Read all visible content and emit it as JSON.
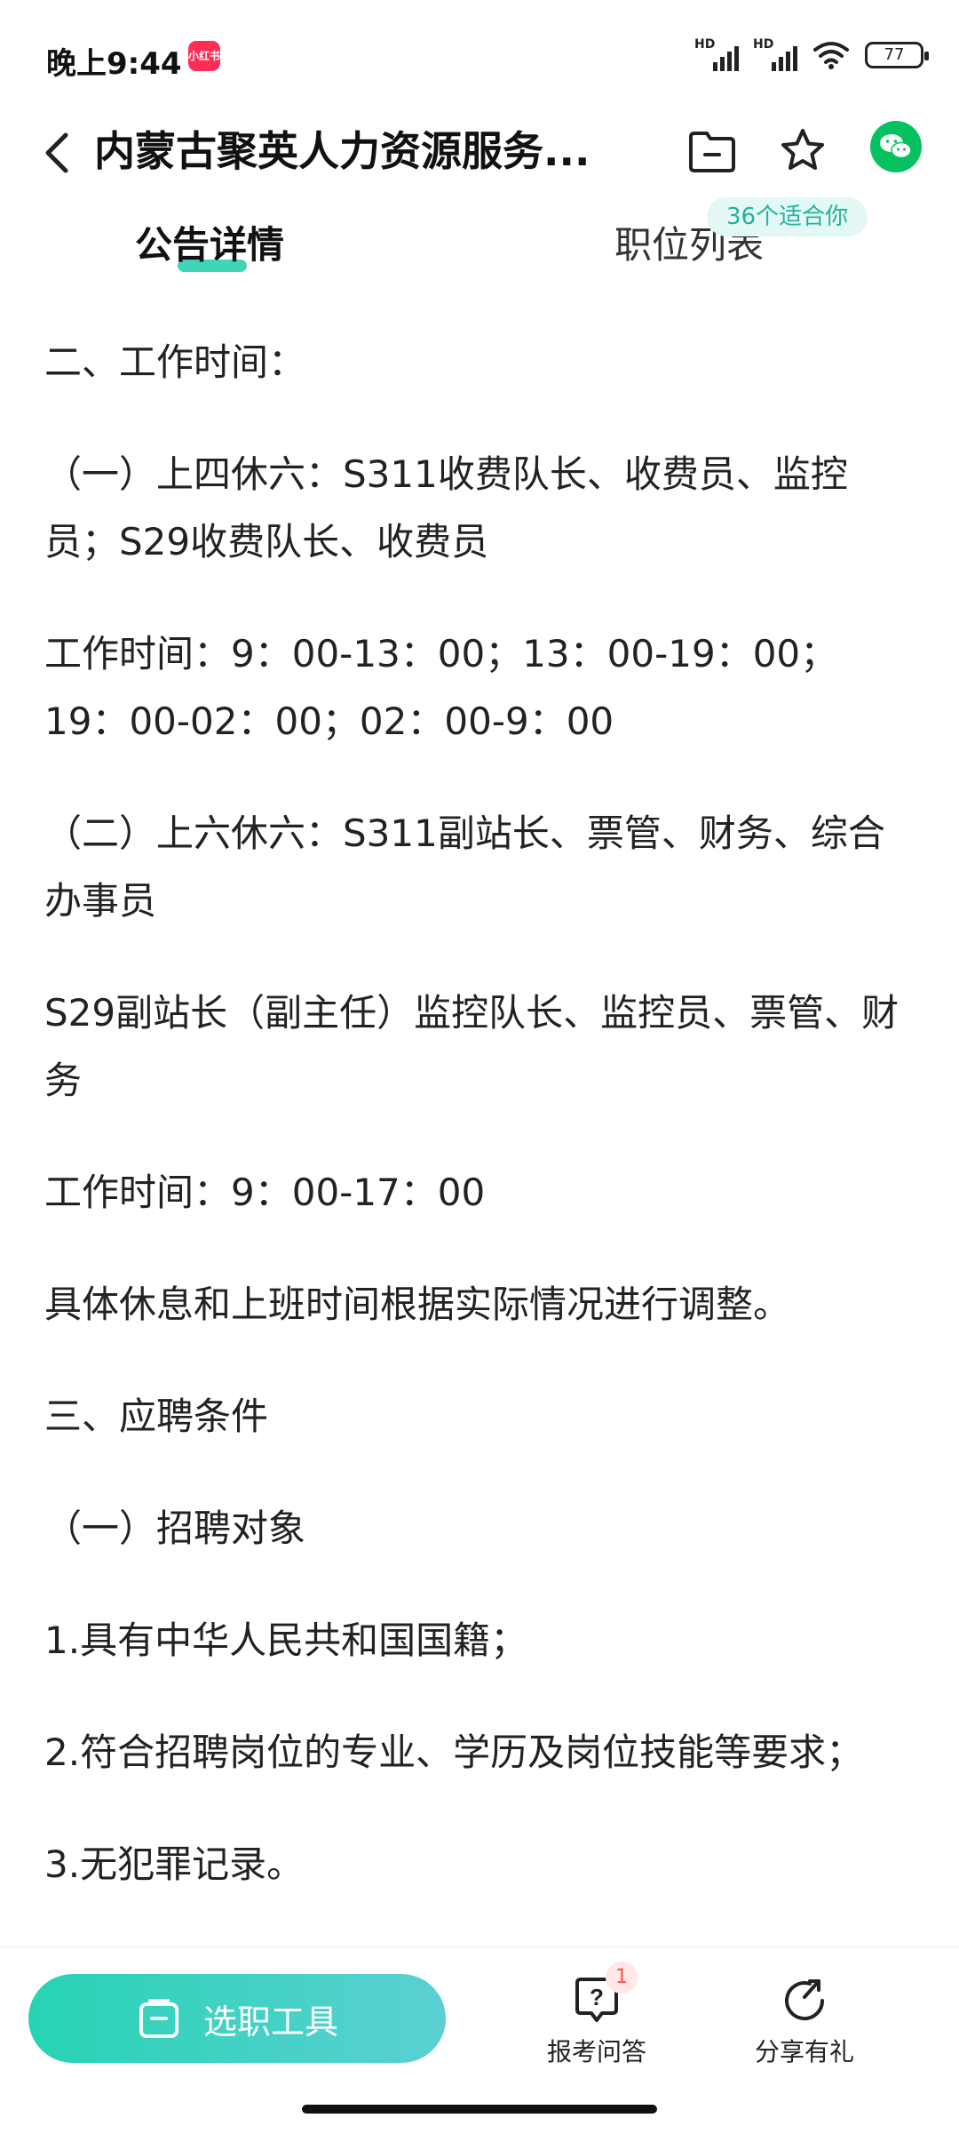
{
  "status": {
    "time": "晚上9:44",
    "app_badge": "小红书",
    "hd1": "HD",
    "hd2": "HD",
    "battery": "77"
  },
  "header": {
    "title": "内蒙古聚英人力资源服务..."
  },
  "tabs": {
    "active": "公告详情",
    "inactive": "职位列表",
    "badge": "36个适合你"
  },
  "content": {
    "paragraphs": [
      "二、工作时间：",
      "（一）上四休六：S311收费队长、收费员、监控员；S29收费队长、收费员",
      "工作时间：9：00-13：00；13：00-19：00；19：00-02：00；02：00-9：00",
      "（二）上六休六：S311副站长、票管、财务、综合办事员",
      "S29副站长（副主任）监控队长、监控员、票管、财务",
      "工作时间：9：00-17：00",
      "具体休息和上班时间根据实际情况进行调整。",
      "三、应聘条件",
      "（一）招聘对象",
      "1.具有中华人民共和国国籍；",
      "2.符合招聘岗位的专业、学历及岗位技能等要求；",
      "3.无犯罪记录。"
    ]
  },
  "bottom": {
    "tool_label": "选职工具",
    "qa_label": "报考问答",
    "qa_badge": "1",
    "share_label": "分享有礼"
  },
  "colors": {
    "accent": "#2cd0b0",
    "wechat": "#07c160"
  }
}
